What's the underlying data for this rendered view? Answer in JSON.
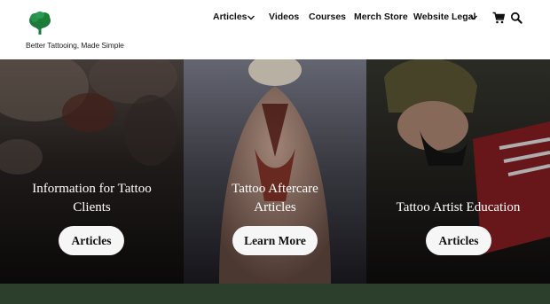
{
  "brand": {
    "tagline": "Better Tattooing, Made Simple",
    "logo_icon": "tree-icon",
    "logo_color": "#1e7a3a"
  },
  "nav": {
    "items": [
      {
        "label": "Articles",
        "has_dropdown": true
      },
      {
        "label": "Videos",
        "has_dropdown": false
      },
      {
        "label": "Courses",
        "has_dropdown": false
      },
      {
        "label": "Merch Store",
        "has_dropdown": false
      },
      {
        "label": "Website Legal",
        "has_dropdown": true
      }
    ],
    "cart_icon": "cart-icon",
    "search_icon": "search-icon"
  },
  "hero": {
    "panels": [
      {
        "title_line1": "Information for Tattoo",
        "title_line2": "Clients",
        "button": "Articles"
      },
      {
        "title_line1": "Tattoo Aftercare",
        "title_line2": "Articles",
        "button": "Learn More"
      },
      {
        "title_line1": "Tattoo Artist Education",
        "title_line2": "",
        "button": "Articles"
      }
    ]
  },
  "colors": {
    "footer_band": "#2b3f2c",
    "button_bg": "#f6f6f6",
    "text_dark": "#111111"
  }
}
